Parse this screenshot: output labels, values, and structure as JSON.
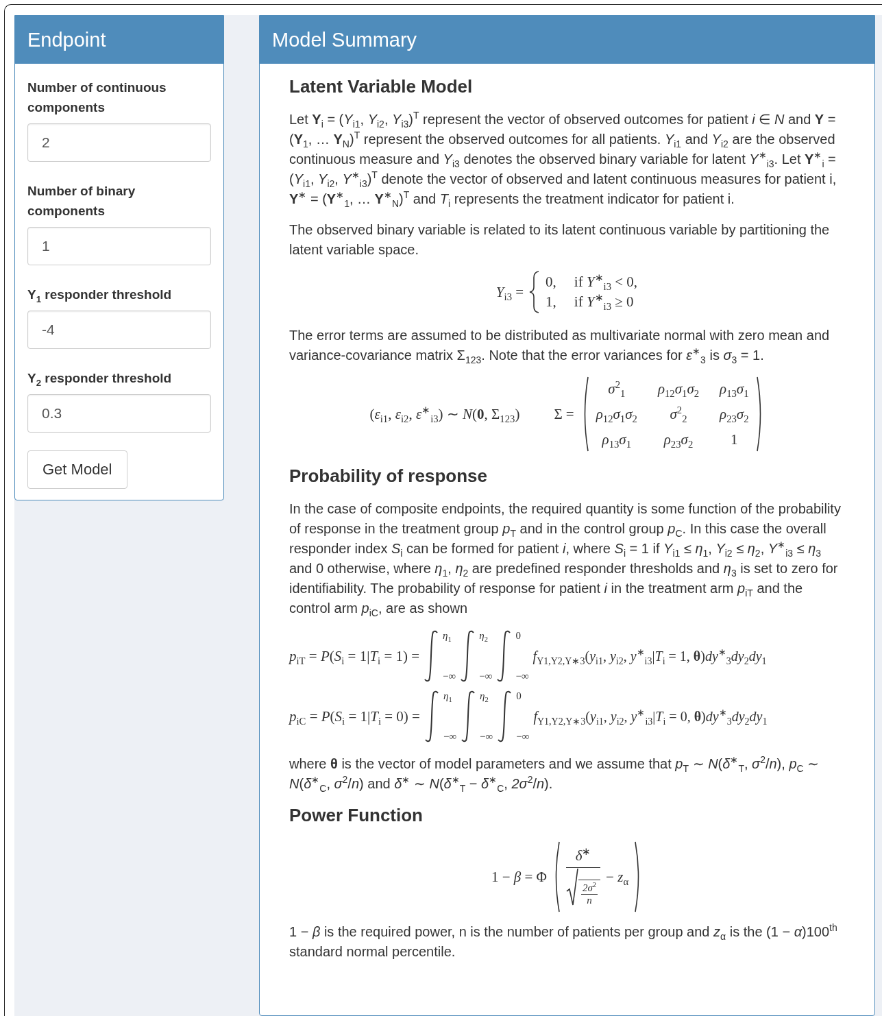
{
  "endpoint": {
    "title": "Endpoint",
    "fields": [
      {
        "label": "Number of continuous components",
        "value": "2"
      },
      {
        "label": "Number of binary components",
        "value": "1"
      },
      {
        "label": "Y$_{1}$ responder threshold",
        "value": "-4"
      },
      {
        "label": "Y$_{2}$ responder threshold",
        "value": "0.3"
      }
    ],
    "button": "Get Model"
  },
  "model_summary": {
    "title": "Model Summary",
    "sections": [
      {
        "heading": "Latent Variable Model",
        "blocks": [
          {
            "kind": "paragraph",
            "text": "Let **Y**$_{i}$ = (*Y*$_{i1}$, *Y*$_{i2}$, *Y*$_{i3}$)$^{T}$ represent the vector of observed outcomes for patient *i* ∈ *N* and **Y** = (**Y**$_{1}$, … **Y**$_{N}$)$^{T}$ represent the observed outcomes for all patients. *Y*$_{i1}$ and *Y*$_{i2}$ are the observed continuous measure and *Y*$_{i3}$ denotes the observed binary variable for latent *Y*$^{∗}$$_{i3}$. Let **Y**$^{∗}$$_{i}$ = (*Y*$_{i1}$, *Y*$_{i2}$, *Y*$^{∗}$$_{i3}$)$^{T}$ denote the vector of observed and latent continuous measures for patient i, **Y**$^{∗}$ = (**Y**$^{∗}$$_{1}$, … **Y**$^{∗}$$_{N}$)$^{T}$ and *T*$_{i}$ represents the treatment indicator for patient i."
          },
          {
            "kind": "paragraph",
            "text": "The observed binary variable is related to its latent continuous variable by partitioning the latent variable space."
          },
          {
            "kind": "cases",
            "lhs": "*Y*$_{i3}$ =",
            "cases": [
              {
                "value": "0,",
                "condition": "if *Y*$^{∗}$$_{i3}$ < 0,"
              },
              {
                "value": "1,",
                "condition": "if *Y*$^{∗}$$_{i3}$ ≥ 0"
              }
            ]
          },
          {
            "kind": "paragraph",
            "text": "The error terms are assumed to be distributed as multivariate normal with zero mean and variance-covariance matrix Σ$_{123}$. Note that the error variances for *ε*$^{∗}$$_{3}$ is *σ*$_{3}$ = 1."
          },
          {
            "kind": "matrix",
            "lhs": "(*ε*$_{i1}$, *ε*$_{i2}$, *ε*$^{∗}$$_{i3}$) ∼ *N*(**0**, Σ$_{123}$)",
            "name": "Σ =",
            "rows": [
              [
                "*σ*$^{2}$$_{1}$",
                "*ρ*$_{12}$*σ*$_{1}$*σ*$_{2}$",
                "*ρ*$_{13}$*σ*$_{1}$"
              ],
              [
                "*ρ*$_{12}$*σ*$_{1}$*σ*$_{2}$",
                "*σ*$^{2}$$_{2}$",
                "*ρ*$_{23}$*σ*$_{2}$"
              ],
              [
                "*ρ*$_{13}$*σ*$_{1}$",
                "*ρ*$_{23}$*σ*$_{2}$",
                "1"
              ]
            ]
          }
        ]
      },
      {
        "heading": "Probability of response",
        "blocks": [
          {
            "kind": "paragraph",
            "text": "In the case of composite endpoints, the required quantity is some function of the probability of response in the treatment group *p*$_{T}$ and in the control group *p*$_{C}$. In this case the overall responder index *S*$_{i}$ can be formed for patient *i*, where *S*$_{i}$ = 1 if *Y*$_{i1}$ ≤ *η*$_{1}$, *Y*$_{i2}$ ≤ *η*$_{2}$, *Y*$^{∗}$$_{i3}$ ≤ *η*$_{3}$ and 0 otherwise, where *η*$_{1}$, *η*$_{2}$ are predefined responder thresholds and *η*$_{3}$ is set to zero for identifiability. The probability of response for patient *i* in the treatment arm *p*$_{iT}$ and the control arm *p*$_{iC}$, are as shown"
          },
          {
            "kind": "integrals",
            "rows": [
              {
                "lhs": "*p*$_{iT}$ = *P*(*S*$_{i}$ = 1|*T*$_{i}$ = 1) =",
                "limits": [
                  {
                    "upper": "*η*$_{1}$",
                    "lower": "−∞"
                  },
                  {
                    "upper": "*η*$_{2}$",
                    "lower": "−∞"
                  },
                  {
                    "upper": "0",
                    "lower": "−∞"
                  }
                ],
                "integrand": "*f*$_{Y1,Y2,Y∗3}$(*y*$_{i1}$, *y*$_{i2}$, *y*$^{∗}$$_{i3}$|*T*$_{i}$ = 1, **θ**)*dy*$^{∗}$$_{3}$*dy*$_{2}$*dy*$_{1}$"
              },
              {
                "lhs": "*p*$_{iC}$ = *P*(*S*$_{i}$ = 1|*T*$_{i}$ = 0) =",
                "limits": [
                  {
                    "upper": "*η*$_{1}$",
                    "lower": "−∞"
                  },
                  {
                    "upper": "*η*$_{2}$",
                    "lower": "−∞"
                  },
                  {
                    "upper": "0",
                    "lower": "−∞"
                  }
                ],
                "integrand": "*f*$_{Y1,Y2,Y∗3}$(*y*$_{i1}$, *y*$_{i2}$, *y*$^{∗}$$_{i3}$|*T*$_{i}$ = 0, **θ**)*dy*$^{∗}$$_{3}$*dy*$_{2}$*dy*$_{1}$"
              }
            ]
          },
          {
            "kind": "paragraph",
            "text": "where **θ** is the vector of model parameters and we assume that *p*$_{T}$ ∼ *N*(*δ*$^{∗}$$_{T}$, *σ*$^{2}$/*n*), *p*$_{C}$ ∼ *N*(*δ*$^{∗}$$_{C}$, *σ*$^{2}$/*n*) and *δ*$^{∗}$ ∼ *N*(*δ*$^{∗}$$_{T}$ − *δ*$^{∗}$$_{C}$, *2σ*$^{2}$/*n*)."
          }
        ]
      },
      {
        "heading": "Power Function",
        "blocks": [
          {
            "kind": "power",
            "lhs": "1 − *β* = Φ",
            "numerator": "*δ*$^{∗}$",
            "radicand_top": "*2σ*$^{2}$",
            "radicand_bottom": "*n*",
            "tail": "− *z*$_{α}$"
          },
          {
            "kind": "paragraph",
            "text": "1 − *β* is the required power, n is the number of patients per group and *z*$_{α}$ is the (1 − *α*)100$^{th}$ standard normal percentile."
          }
        ]
      }
    ]
  }
}
